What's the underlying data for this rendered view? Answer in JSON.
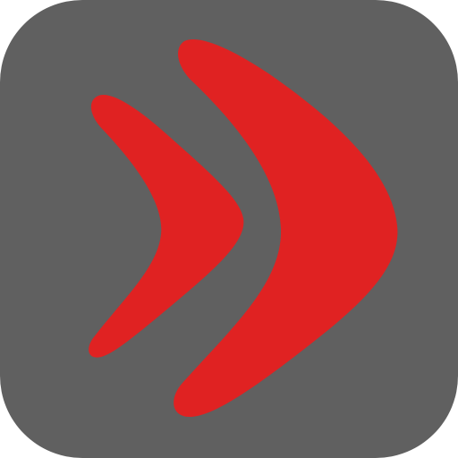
{
  "icon": {
    "name": "red-chevron-app-icon",
    "glyph": "double-chevron-right-icon",
    "colors": {
      "tile": "#606060",
      "chevron": "#e02222",
      "page": "#ffffff"
    }
  }
}
